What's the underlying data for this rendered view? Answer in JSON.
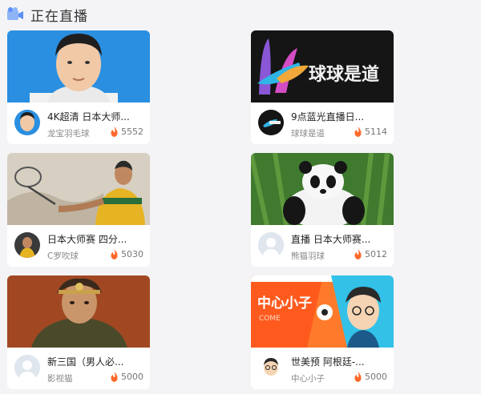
{
  "header": {
    "icon": "camera-icon",
    "title": "正在直播"
  },
  "colors": {
    "accent": "#5b8ff9",
    "flame": "#ff6a2b"
  },
  "cards": [
    {
      "title": "4K超清 日本大师...",
      "streamer": "龙宝羽毛球",
      "heat": "5552"
    },
    {
      "title": "9点蓝光直播日...",
      "streamer": "球球是道",
      "heat": "5114",
      "logo_text": "球球是道"
    },
    {
      "title": "日本大师赛 四分...",
      "streamer": "C罗吹球",
      "heat": "5030"
    },
    {
      "title": "直播 日本大师赛...",
      "streamer": "熊猫羽球",
      "heat": "5012"
    },
    {
      "title": "新三国（男人必...",
      "streamer": "影视猫",
      "heat": "5000"
    },
    {
      "title": "世美预 阿根廷-...",
      "streamer": "中心小子",
      "heat": "5000",
      "banner_text": "中心小子",
      "banner_sub": "COME"
    }
  ]
}
